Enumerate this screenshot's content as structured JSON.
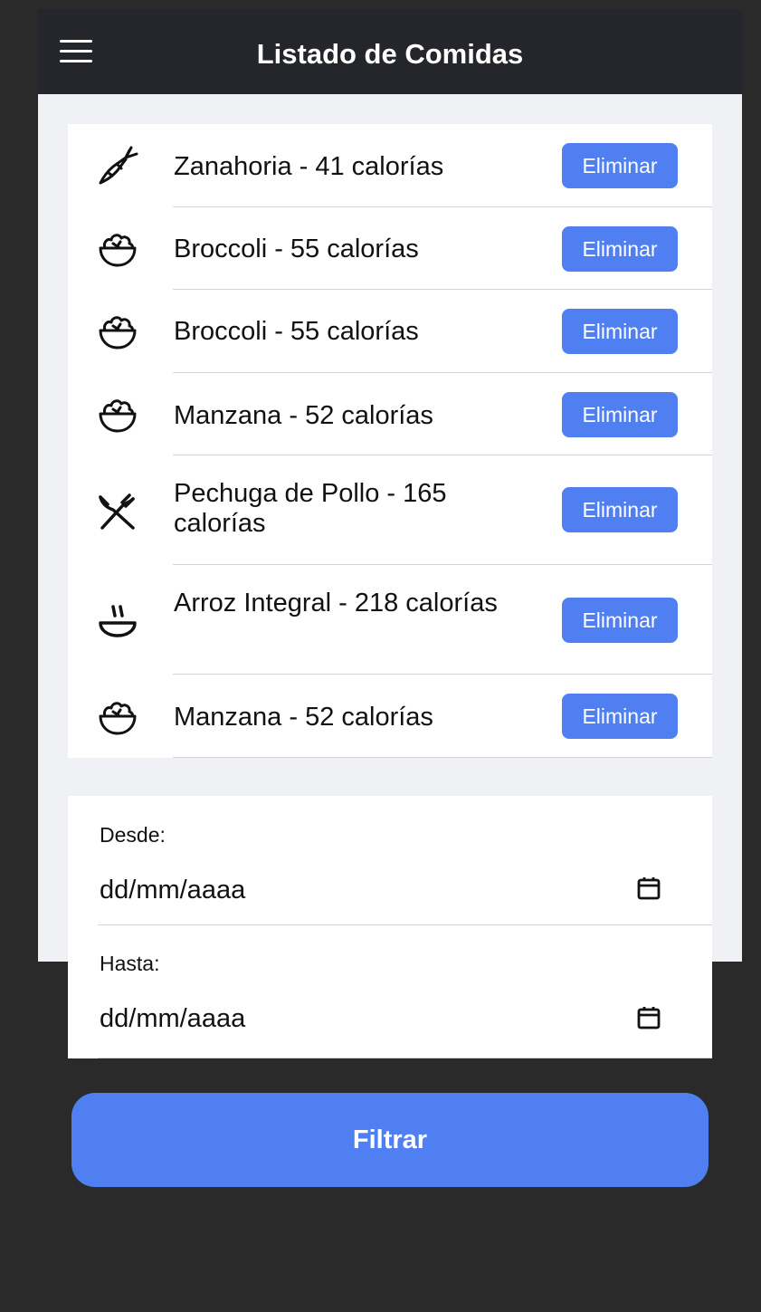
{
  "header": {
    "title": "Listado de Comidas",
    "menu_icon": "hamburger-menu-icon"
  },
  "foods": [
    {
      "text": "Zanahoria - 41 calorías",
      "icon": "carrot-icon",
      "button": "Eliminar"
    },
    {
      "text": "Broccoli - 55 calorías",
      "icon": "salad-bowl-icon",
      "button": "Eliminar"
    },
    {
      "text": "Broccoli - 55 calorías",
      "icon": "salad-bowl-icon",
      "button": "Eliminar"
    },
    {
      "text": "Manzana - 52 calorías",
      "icon": "salad-bowl-icon",
      "button": "Eliminar"
    },
    {
      "text": "Pechuga de Pollo - 165 calorías",
      "icon": "fork-knife-icon",
      "button": "Eliminar"
    },
    {
      "text": "Arroz Integral - 218 calorías",
      "icon": "steaming-bowl-icon",
      "button": "Eliminar"
    },
    {
      "text": "Manzana - 52 calorías",
      "icon": "salad-bowl-icon",
      "button": "Eliminar"
    }
  ],
  "filters": {
    "from_label": "Desde:",
    "from_value": "dd/mm/aaaa",
    "to_label": "Hasta:",
    "to_value": "dd/mm/aaaa",
    "calendar_icon": "calendar-icon"
  },
  "filter_button": "Filtrar",
  "colors": {
    "header_bg": "#24262b",
    "accent": "#4f7ff1",
    "page_bg": "#f0f1f5",
    "frame_bg": "#2a2a2a"
  }
}
